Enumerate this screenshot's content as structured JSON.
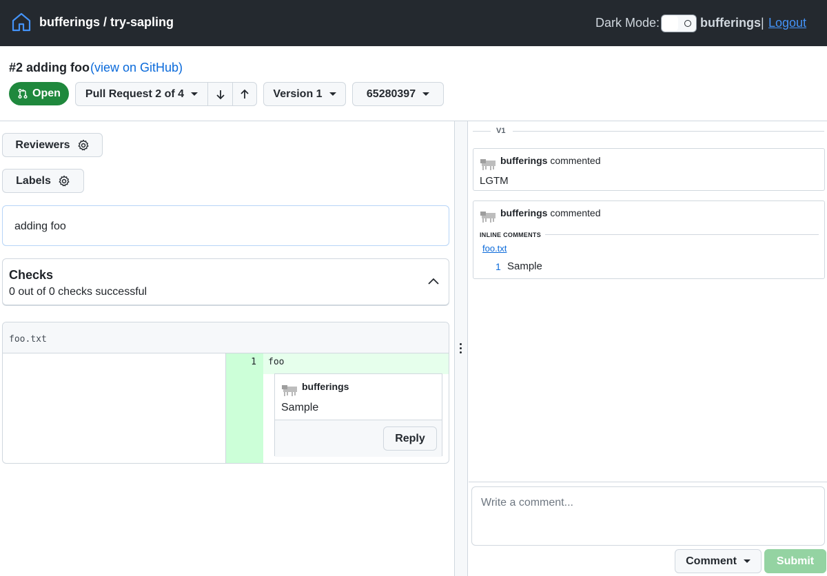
{
  "topbar": {
    "repo_title": "bufferings / try-sapling",
    "dark_mode_label": "Dark Mode:",
    "username": "bufferings",
    "separator": "|",
    "logout_label": "Logout"
  },
  "pr": {
    "title": "#2 adding foo",
    "github_link": "(view on GitHub)",
    "status": "Open",
    "stack_selector": "Pull Request 2 of 4",
    "version_selector": "Version 1",
    "commit_selector": "65280397"
  },
  "sidebar": {
    "reviewers_label": "Reviewers",
    "labels_label": "Labels",
    "description": "adding foo"
  },
  "checks": {
    "title": "Checks",
    "summary": "0 out of 0 checks successful"
  },
  "diff": {
    "file_name": "foo.txt",
    "line_number": "1",
    "line_code": "foo",
    "inline_comment": {
      "author": "bufferings",
      "body": "Sample",
      "reply_label": "Reply"
    }
  },
  "timeline": {
    "version_label": "V1",
    "comments": [
      {
        "author": "bufferings",
        "action": "commented",
        "body": "LGTM"
      },
      {
        "author": "bufferings",
        "action": "commented",
        "inline_label": "INLINE COMMENTS",
        "file": "foo.txt",
        "line": "1",
        "text": "Sample"
      }
    ]
  },
  "composer": {
    "placeholder": "Write a comment...",
    "comment_type_label": "Comment",
    "submit_label": "Submit"
  },
  "colors": {
    "topbar_bg": "#24292f",
    "open_badge": "#1f883d",
    "link": "#0969da",
    "added_line": "#ccffd8",
    "submit_disabled": "#94d3a2"
  }
}
